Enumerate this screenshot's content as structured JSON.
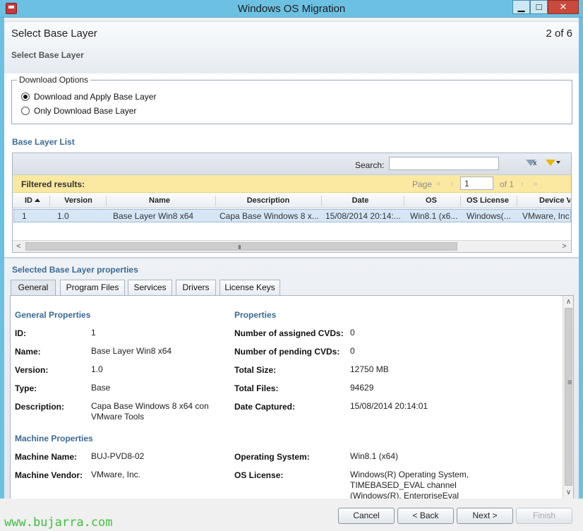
{
  "window": {
    "title": "Windows OS Migration",
    "minimize_glyph": "▁",
    "maximize_glyph": "□",
    "close_glyph": "✕",
    "app_icon": "app-icon"
  },
  "header": {
    "title": "Select Base Layer",
    "step": "2 of 6",
    "subtitle": "Select Base Layer"
  },
  "download_options": {
    "legend": "Download Options",
    "options": [
      {
        "label": "Download and Apply Base Layer",
        "selected": true
      },
      {
        "label": "Only Download Base Layer",
        "selected": false
      }
    ]
  },
  "base_layer_list": {
    "title": "Base Layer List",
    "search_label": "Search:",
    "search_value": "",
    "filtered_label": "Filtered results:",
    "page_label": "Page",
    "page_value": "1",
    "of_label": "of 1",
    "nav_first": "«",
    "nav_prev": "‹",
    "nav_next": "›",
    "nav_last": "»",
    "columns": [
      "ID",
      "Version",
      "Name",
      "Description",
      "Date",
      "OS",
      "OS License",
      "Device V"
    ],
    "rows": [
      [
        "1",
        "1.0",
        "Base Layer Win8 x64",
        "Capa Base Windows 8 x...",
        "15/08/2014 20:14:...",
        "Win8.1 (x6...",
        "Windows(...",
        "VMware, Inc"
      ]
    ],
    "scroll_left": "<",
    "scroll_right": ">",
    "scroll_grip": "III"
  },
  "properties": {
    "title": "Selected Base Layer properties",
    "tabs": [
      "General",
      "Program Files",
      "Services",
      "Drivers",
      "License Keys"
    ],
    "active_tab": "General",
    "general_heading": "General Properties",
    "general": [
      {
        "key": "ID:",
        "value": "1"
      },
      {
        "key": "Name:",
        "value": "Base Layer Win8 x64"
      },
      {
        "key": "Version:",
        "value": "1.0"
      },
      {
        "key": "Type:",
        "value": "Base"
      },
      {
        "key": "Description:",
        "value": "Capa Base Windows 8 x64 con VMware Tools"
      }
    ],
    "props_heading": "Properties",
    "props": [
      {
        "key": "Number of assigned CVDs:",
        "value": "0"
      },
      {
        "key": "Number of pending CVDs:",
        "value": "0"
      },
      {
        "key": "Total Size:",
        "value": "12750 MB"
      },
      {
        "key": "Total Files:",
        "value": "94629"
      },
      {
        "key": "Date Captured:",
        "value": "15/08/2014 20:14:01"
      }
    ],
    "machine_heading": "Machine Properties",
    "machine": [
      {
        "key": "Machine Name:",
        "value": "BUJ-PVD8-02"
      },
      {
        "key": "Machine Vendor:",
        "value": "VMware, Inc."
      }
    ],
    "machine_right": [
      {
        "key": "Operating System:",
        "value": "Win8.1 (x64)"
      },
      {
        "key": "OS License:",
        "value": "Windows(R) Operating System, TIMEBASED_EVAL channel (Windows(R), EnterpriseEval"
      }
    ],
    "vscroll_up": "∧",
    "vscroll_down": "∨",
    "vscroll_grip": "≡"
  },
  "footer": {
    "watermark": "www.bujarra.com",
    "cancel": "Cancel",
    "back": "< Back",
    "next": "Next >",
    "finish": "Finish"
  }
}
